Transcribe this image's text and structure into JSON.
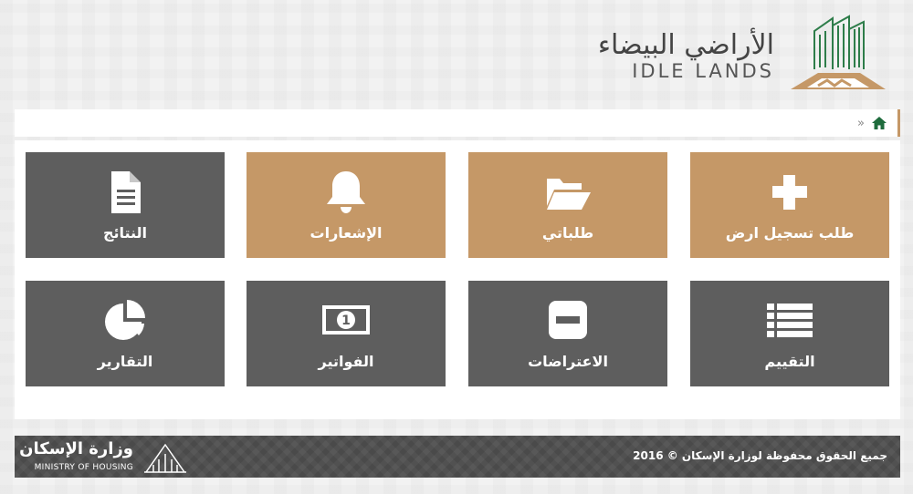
{
  "header": {
    "logo_ar": "الأراضي البيضاء",
    "logo_en": "IDLE LANDS"
  },
  "breadcrumb": {
    "separator": "»",
    "home_icon": "home-icon"
  },
  "tiles": [
    {
      "label": "طلب تسجيل ارض",
      "icon": "plus-icon",
      "color": "#c59867"
    },
    {
      "label": "طلباتي",
      "icon": "folder-open-icon",
      "color": "#c59867"
    },
    {
      "label": "الإشعارات",
      "icon": "bell-icon",
      "color": "#c59867"
    },
    {
      "label": "النتائج",
      "icon": "document-icon",
      "color": "#5e5e5e"
    },
    {
      "label": "التقييم",
      "icon": "list-icon",
      "color": "#5e5e5e"
    },
    {
      "label": "الاعتراضات",
      "icon": "minus-square-icon",
      "color": "#5e5e5e"
    },
    {
      "label": "الفواتير",
      "icon": "money-bill-icon",
      "color": "#5e5e5e"
    },
    {
      "label": "التقارير",
      "icon": "pie-chart-icon",
      "color": "#5e5e5e"
    }
  ],
  "footer": {
    "copyright": "جميع الحقوق محفوظة لوزارة الإسكان © 2016",
    "ministry_ar": "وزارة الإسكان",
    "ministry_en": "MINISTRY OF HOUSING"
  },
  "colors": {
    "accent_gold": "#c59867",
    "tile_gray": "#5e5e5e",
    "home_green": "#1e6b3c",
    "footer_bg": "#4a4a4a"
  }
}
